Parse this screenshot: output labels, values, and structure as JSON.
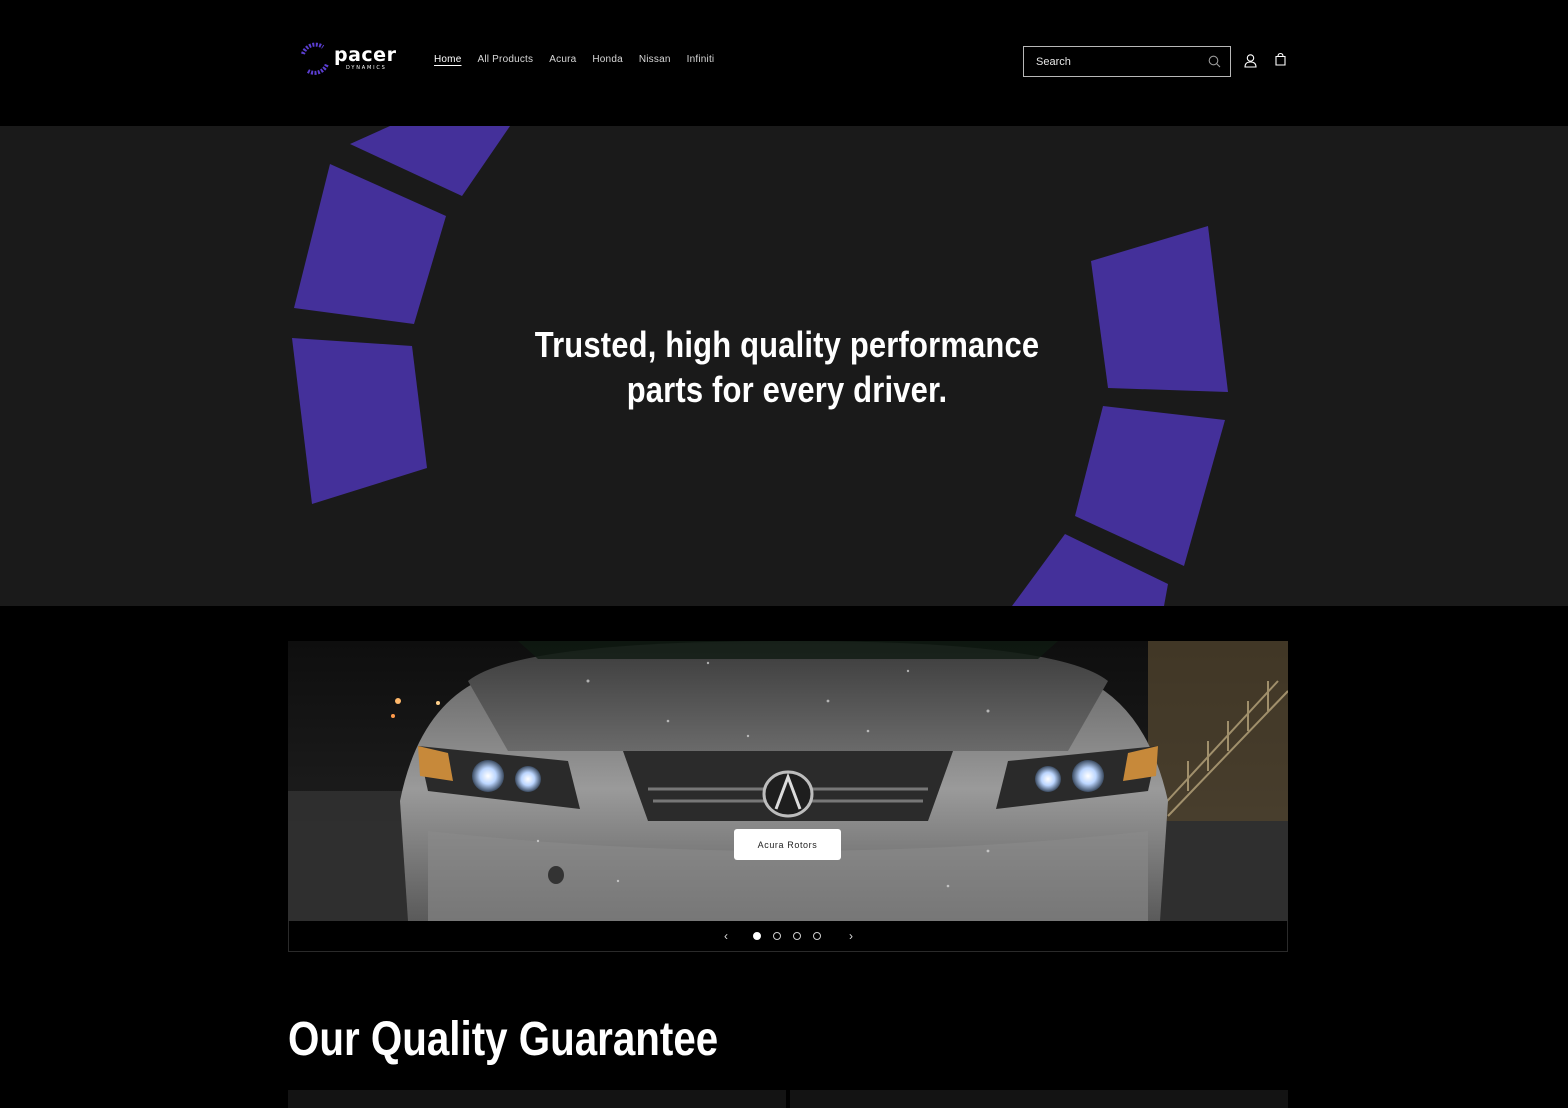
{
  "header": {
    "logo": {
      "word": "pacer",
      "sub": "DYNAMICS"
    },
    "nav": [
      {
        "label": "Home",
        "active": true
      },
      {
        "label": "All Products",
        "active": false
      },
      {
        "label": "Acura",
        "active": false
      },
      {
        "label": "Honda",
        "active": false
      },
      {
        "label": "Nissan",
        "active": false
      },
      {
        "label": "Infiniti",
        "active": false
      }
    ],
    "search": {
      "placeholder": "Search"
    },
    "icons": [
      "search-icon",
      "account-icon",
      "cart-icon"
    ]
  },
  "hero": {
    "title": "Trusted, high quality performance parts for every driver.",
    "accent_color": "#44309a",
    "background_color": "#1a1a1a"
  },
  "slideshow": {
    "button_label": "Acura Rotors",
    "prev_label": "‹",
    "next_label": "›",
    "slide_count": 4,
    "active_slide": 1
  },
  "quality": {
    "title": "Our Quality Guarantee"
  }
}
